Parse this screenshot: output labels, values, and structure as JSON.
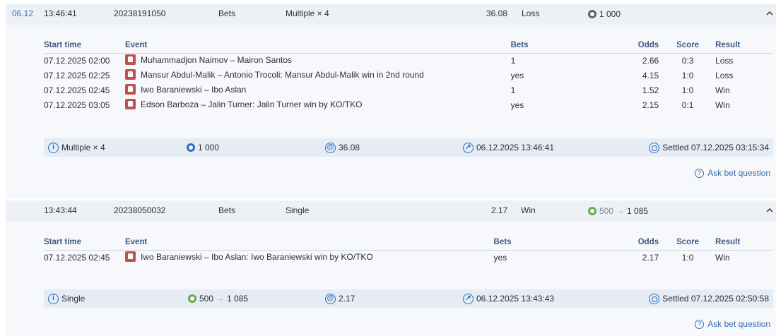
{
  "bets": [
    {
      "header": {
        "date": "06.12",
        "time": "13:46:41",
        "bet_id": "20238191050",
        "type": "Bets",
        "kind": "Multiple × 4",
        "odds": "36.08",
        "result": "Loss",
        "stake": "1 000",
        "payout": ""
      },
      "columns": [
        "Start time",
        "Event",
        "Bets",
        "Odds",
        "Score",
        "Result"
      ],
      "events": [
        {
          "start": "07.12.2025 02:00",
          "event": "Muhammadjon Naimov – Mairon Santos",
          "bet": "1",
          "odds": "2.66",
          "score": "0:3",
          "result": "Loss"
        },
        {
          "start": "07.12.2025 02:25",
          "event": "Mansur Abdul-Malik – Antonio Trocoli: Mansur Abdul-Malik win in 2nd round",
          "bet": "yes",
          "odds": "4.15",
          "score": "1:0",
          "result": "Loss"
        },
        {
          "start": "07.12.2025 02:45",
          "event": "Iwo Baraniewski – Ibo Aslan",
          "bet": "1",
          "odds": "1.52",
          "score": "1:0",
          "result": "Win"
        },
        {
          "start": "07.12.2025 03:05",
          "event": "Edson Barboza – Jalin Turner: Jalin Turner win by KO/TKO",
          "bet": "yes",
          "odds": "2.15",
          "score": "0:1",
          "result": "Win"
        }
      ],
      "summary": {
        "kind": "Multiple × 4",
        "stake": "1 000",
        "payout": "",
        "odds": "36.08",
        "placed": "06.12.2025 13:46:41",
        "settled": "Settled 07.12.2025 03:15:34"
      },
      "ask_label": "Ask bet question"
    },
    {
      "header": {
        "date": "",
        "time": "13:43:44",
        "bet_id": "20238050032",
        "type": "Bets",
        "kind": "Single",
        "odds": "2.17",
        "result": "Win",
        "stake": "500",
        "payout": "1 085"
      },
      "columns": [
        "Start time",
        "Event",
        "Bets",
        "Odds",
        "Score",
        "Result"
      ],
      "events": [
        {
          "start": "07.12.2025 02:45",
          "event": "Iwo Baraniewski – Ibo Aslan: Iwo Baraniewski win by KO/TKO",
          "bet": "yes",
          "odds": "2.17",
          "score": "1:0",
          "result": "Win"
        }
      ],
      "summary": {
        "kind": "Single",
        "stake": "500",
        "payout": "1 085",
        "odds": "2.17",
        "placed": "06.12.2025 13:43:43",
        "settled": "Settled 07.12.2025 02:50:58"
      },
      "ask_label": "Ask bet question"
    }
  ],
  "icons": {
    "expand": "chevron-up-icon",
    "sport": "mma-glove-icon",
    "coin_loss": "coin-icon",
    "coin_win": "coin-win-icon",
    "info": "info-icon",
    "odds": "at-icon",
    "placed": "clock-icon",
    "settled": "target-icon",
    "ask": "question-icon"
  },
  "colors": {
    "header_bg": "#edf1f6",
    "body_bg": "#f6f8fb",
    "summary_bg": "#e6ecf3",
    "accent": "#2a6cc4",
    "win_coin": "#6aa84f",
    "sport_icon": "#c0524e"
  }
}
